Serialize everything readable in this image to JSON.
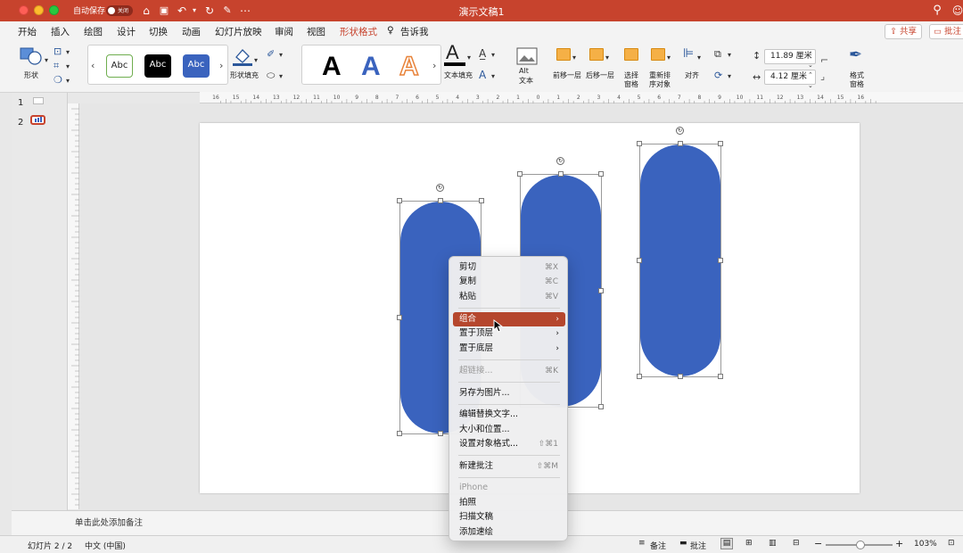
{
  "window": {
    "title": "演示文稿1",
    "autosave_label": "自动保存",
    "autosave_state": "关闭"
  },
  "tabs": [
    "开始",
    "插入",
    "绘图",
    "设计",
    "切换",
    "动画",
    "幻灯片放映",
    "审阅",
    "视图",
    "形状格式",
    "告诉我"
  ],
  "active_tab": "形状格式",
  "header_buttons": {
    "share": "共享",
    "comments": "批注"
  },
  "ribbon": {
    "shapes_label": "形状",
    "style_samples": [
      "Abc",
      "Abc",
      "Abc"
    ],
    "shape_fill_label": "形状填充",
    "wordart_samples": [
      "A",
      "A",
      "A"
    ],
    "text_fill_label": "文本填充",
    "alt_text_label": [
      "Alt",
      "文本"
    ],
    "bring_forward_label": "前移一层",
    "send_backward_label": "后移一层",
    "selection_pane_label": [
      "选择",
      "窗格"
    ],
    "reorder_label": [
      "重新排",
      "序对象"
    ],
    "align_label": "对齐",
    "height_value": "11.89 厘米",
    "width_value": "4.12 厘米",
    "format_pane_label": [
      "格式",
      "窗格"
    ]
  },
  "ruler_labels": [
    "16",
    "15",
    "14",
    "13",
    "12",
    "11",
    "10",
    "9",
    "8",
    "7",
    "6",
    "5",
    "4",
    "3",
    "2",
    "1",
    "0",
    "1",
    "2",
    "3",
    "4",
    "5",
    "6",
    "7",
    "8",
    "9",
    "10",
    "11",
    "12",
    "13",
    "14",
    "15",
    "16"
  ],
  "thumbnails": [
    "1",
    "2"
  ],
  "context_menu": {
    "items": [
      {
        "label": "剪切",
        "shortcut": "⌘X"
      },
      {
        "label": "复制",
        "shortcut": "⌘C"
      },
      {
        "label": "粘贴",
        "shortcut": "⌘V"
      },
      {
        "label": "组合",
        "submenu": "›",
        "highlighted": true
      },
      {
        "label": "置于顶层",
        "submenu": "›"
      },
      {
        "label": "置于底层",
        "submenu": "›"
      },
      {
        "label": "超链接...",
        "shortcut": "⌘K",
        "disabled": true
      },
      {
        "label": "另存为图片..."
      },
      {
        "label": "编辑替换文字..."
      },
      {
        "label": "大小和位置..."
      },
      {
        "label": "设置对象格式...",
        "shortcut": "⇧⌘1"
      },
      {
        "label": "新建批注",
        "shortcut": "⇧⌘M"
      },
      {
        "label": "iPhone",
        "disabled": true
      },
      {
        "label": "拍照"
      },
      {
        "label": "扫描文稿"
      },
      {
        "label": "添加速绘"
      }
    ]
  },
  "notes_placeholder": "单击此处添加备注",
  "status": {
    "slide_indicator": "幻灯片 2 / 2",
    "language": "中文 (中国)",
    "notes_label": "备注",
    "comments_label": "批注",
    "zoom": "103%",
    "zoom_level": 0.52
  },
  "colors": {
    "accent": "#c7432d",
    "shape_fill": "#3a63be",
    "menu_highlight": "#b5462d"
  }
}
